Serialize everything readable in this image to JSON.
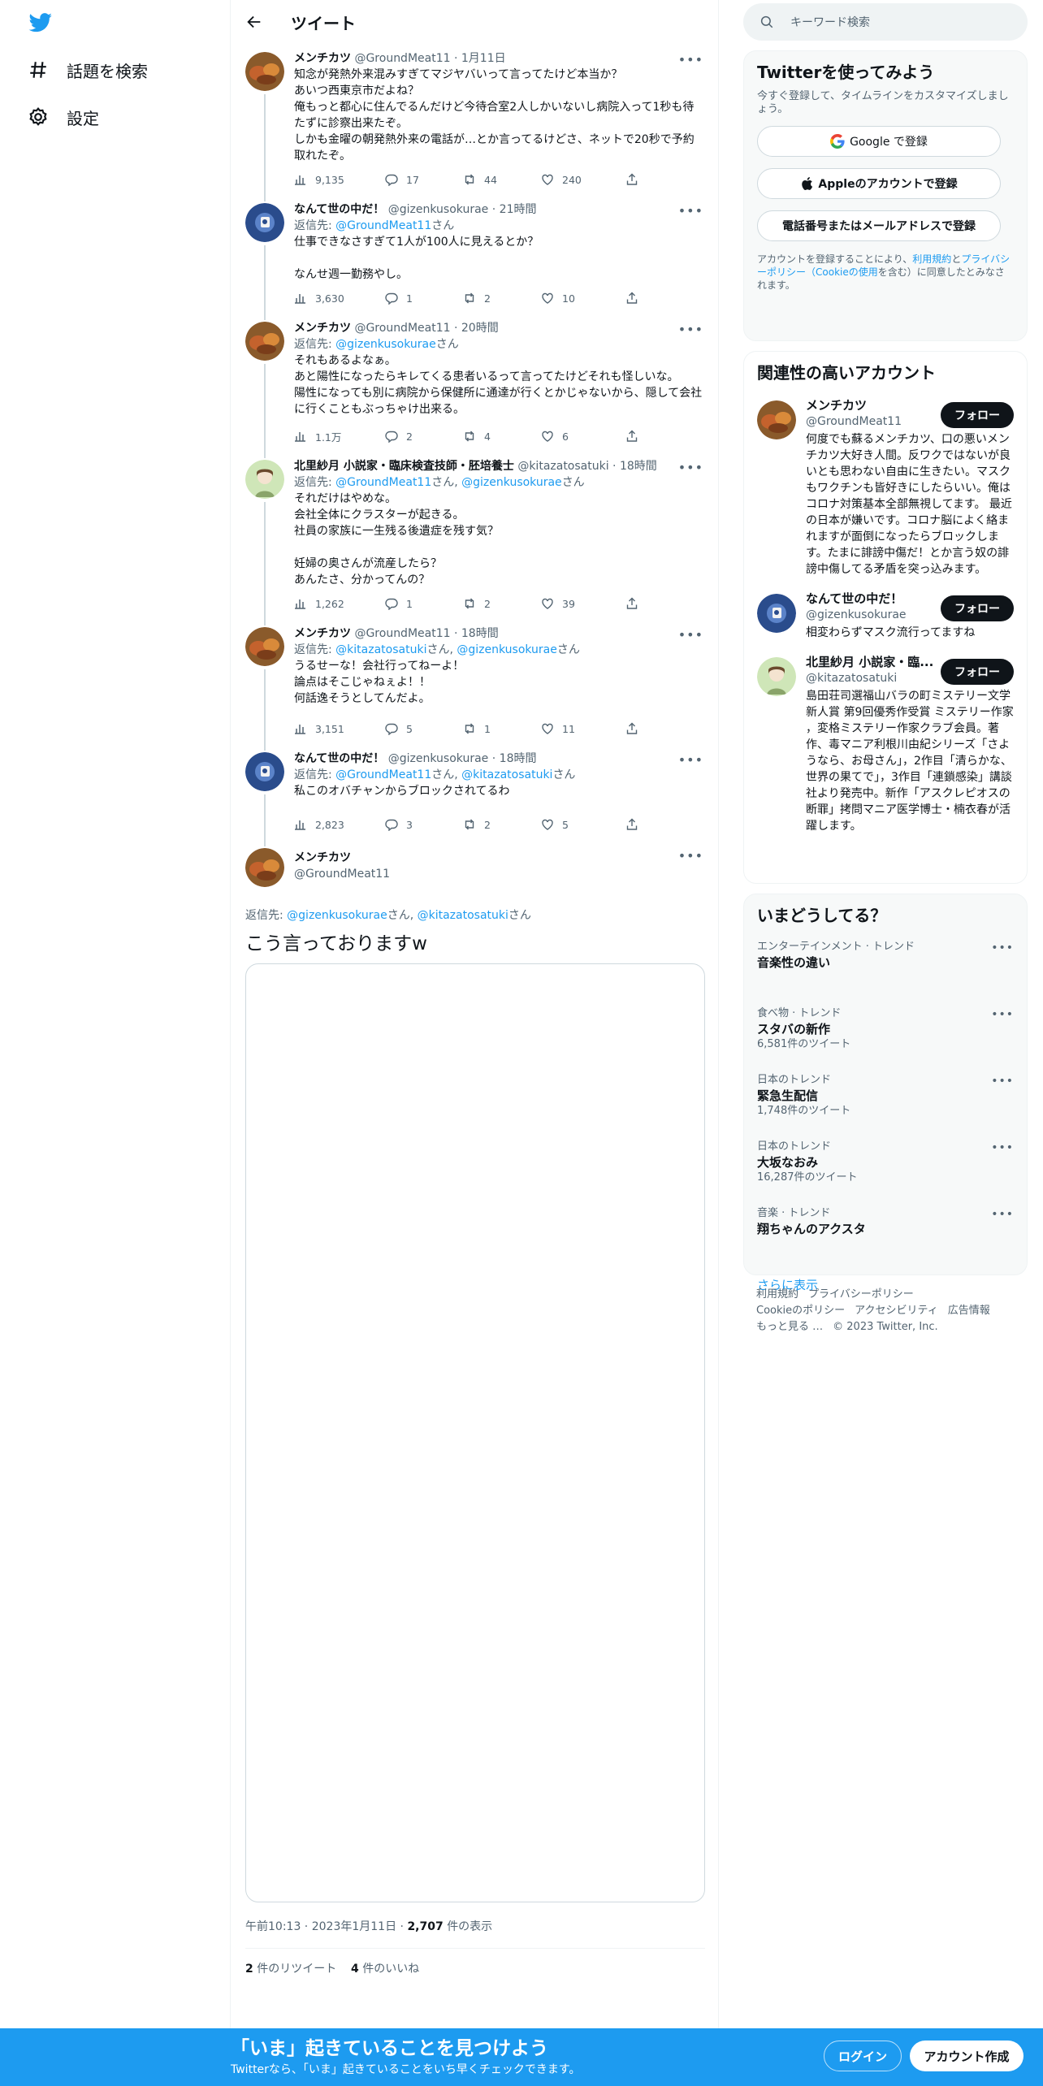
{
  "colors": {
    "accent": "#1d9bf0",
    "text": "#0f1419",
    "muted": "#536471",
    "border": "#eff3f4"
  },
  "nav": {
    "items": [
      {
        "label": "話題を検索",
        "icon": "hashtag-icon"
      },
      {
        "label": "設定",
        "icon": "gear-icon"
      }
    ]
  },
  "header": {
    "title": "ツイート"
  },
  "thread": [
    {
      "name": "メンチカツ",
      "handle": "@GroundMeat11",
      "time": "1月11日",
      "reply_to": "",
      "reply_suffix": "",
      "body": "知念が発熱外来混みすぎてマジヤバいって言ってたけど本当か？\nあいつ西東京市だよね？\n俺もっと都心に住んでるんだけど今待合室2人しかいないし病院入って1秒も待たずに診察出来たぞ。\nしかも金曜の朝発熱外来の電話が…とか言ってるけどさ、ネットで20秒で予約取れたぞ。",
      "views": "9,135",
      "replies": "17",
      "retweets": "44",
      "likes": "240"
    },
    {
      "name": "なんて世の中だ！",
      "handle": "@gizenkusokurae",
      "time": "21時間",
      "reply_to": "@GroundMeat11",
      "reply_suffix": "さん",
      "body": "仕事できなさすぎて1人が100人に見えるとか？\n\nなんせ週一勤務やし。",
      "views": "3,630",
      "replies": "1",
      "retweets": "2",
      "likes": "10"
    },
    {
      "name": "メンチカツ",
      "handle": "@GroundMeat11",
      "time": "20時間",
      "reply_to": "@gizenkusokurae",
      "reply_suffix": "さん",
      "body": "それもあるよなぁ。\nあと陽性になったらキレてくる患者いるって言ってたけどそれも怪しいな。\n陽性になっても別に病院から保健所に通達が行くとかじゃないから、隠して会社に行くこともぶっちゃけ出来る。",
      "views": "1.1万",
      "replies": "2",
      "retweets": "4",
      "likes": "6"
    },
    {
      "name": "北里紗月 小説家・臨床検査技師・胚培養士",
      "handle": "@kitazatosatuki",
      "time": "18時間",
      "reply_to": "@GroundMeat11",
      "reply_suffix": "さん,",
      "reply_to2": "@gizenkusokurae",
      "reply_suffix2": "さん",
      "body": "それだけはやめな。\n会社全体にクラスターが起きる。\n社員の家族に一生残る後遺症を残す気？\n\n妊婦の奥さんが流産したら？\nあんたさ、分かってんの？",
      "views": "1,262",
      "replies": "1",
      "retweets": "2",
      "likes": "39"
    },
    {
      "name": "メンチカツ",
      "handle": "@GroundMeat11",
      "time": "18時間",
      "reply_to": "@kitazatosatuki",
      "reply_suffix": "さん,",
      "reply_to2": "@gizenkusokurae",
      "reply_suffix2": "さん",
      "body": "うるせーな！会社行ってねーよ！\n論点はそこじゃねぇよ！！\n何話逸そうとしてんだよ。",
      "views": "3,151",
      "replies": "5",
      "retweets": "1",
      "likes": "11"
    },
    {
      "name": "なんて世の中だ！",
      "handle": "@gizenkusokurae",
      "time": "18時間",
      "reply_to": "@GroundMeat11",
      "reply_suffix": "さん,",
      "reply_to2": "@kitazatosatuki",
      "reply_suffix2": "さん",
      "body": "私このオバチャンからブロックされてるわ",
      "views": "2,823",
      "replies": "3",
      "retweets": "2",
      "likes": "5"
    }
  ],
  "main_tweet": {
    "name": "メンチカツ",
    "handle": "@GroundMeat11",
    "reply_label": "返信先:",
    "reply_to": "@gizenkusokurae",
    "reply_suffix": "さん,",
    "reply_to2": "@kitazatosatuki",
    "reply_suffix2": "さん",
    "body": "こう言っておりますw",
    "time": "午前10:13",
    "date": "2023年1月11日",
    "views": "2,707",
    "views_label": "件の表示",
    "retweets": "2",
    "retweets_label": "件のリツイート",
    "likes": "4",
    "likes_label": "件のいいね"
  },
  "reply_label": "返信先:",
  "search": {
    "placeholder": "キーワード検索"
  },
  "signup": {
    "title": "Twitterを使ってみよう",
    "subtitle": "今すぐ登録して、タイムラインをカスタマイズしましょう。",
    "google": "Google で登録",
    "apple": "Appleのアカウントで登録",
    "phone": "電話番号またはメールアドレスで登録",
    "legal_1": "アカウントを登録することにより、",
    "legal_terms": "利用規約",
    "legal_and": "と",
    "legal_privacy": "プライバシーポリシー（Cookieの使用",
    "legal_2": "を含む）に同意したとみなされます。"
  },
  "related": {
    "title": "関連性の高いアカウント",
    "follow_label": "フォロー",
    "accounts": [
      {
        "name": "メンチカツ",
        "handle": "@GroundMeat11",
        "bio": "何度でも蘇るメンチカツ、口の悪いメンチカツ大好き人間。反ワクではないが良いとも思わない自由に生きたい。マスクもワクチンも皆好きにしたらいい。俺はコロナ対策基本全部無視してます。 最近の日本が嫌いです。コロナ脳によく絡まれますが面倒になったらブロックします。たまに誹謗中傷だ！とか言う奴の誹謗中傷してる矛盾を突っ込みます。"
      },
      {
        "name": "なんて世の中だ！",
        "handle": "@gizenkusokurae",
        "bio": "相変わらずマスク流行ってますね"
      },
      {
        "name": "北里紗月 小説家・臨...",
        "handle": "@kitazatosatuki",
        "bio": "島田荘司選福山バラの町ミステリー文学新人賞 第9回優秀作受賞 ミステリー作家 ，変格ミステリー作家クラブ会員。著作、毒マニア利根川由紀シリーズ「さようなら、お母さん」，2作目「清らかな、世界の果てで」，3作目「連鎖感染」講談社より発売中。新作「アスクレピオスの断罪」拷問マニア医学博士・楠衣春が活躍します。"
      }
    ]
  },
  "trends": {
    "title": "いまどうしてる？",
    "items": [
      {
        "category": "エンターテインメント · トレンド",
        "name": "音楽性の違い",
        "count": ""
      },
      {
        "category": "食べ物 · トレンド",
        "name": "スタバの新作",
        "count": "6,581件のツイート"
      },
      {
        "category": "日本のトレンド",
        "name": "緊急生配信",
        "count": "1,748件のツイート"
      },
      {
        "category": "日本のトレンド",
        "name": "大坂なおみ",
        "count": "16,287件のツイート"
      },
      {
        "category": "音楽 · トレンド",
        "name": "翔ちゃんのアクスタ",
        "count": ""
      }
    ],
    "show_more": "さらに表示"
  },
  "footer": {
    "links": [
      "利用規約",
      "プライバシーポリシー",
      "Cookieのポリシー",
      "アクセシビリティ",
      "広告情報",
      "もっと見る …"
    ],
    "copyright": "© 2023 Twitter, Inc."
  },
  "bottom_bar": {
    "title": "「いま」起きていることを見つけよう",
    "subtitle": "Twitterなら、「いま」起きていることをいち早くチェックできます。",
    "login": "ログイン",
    "signup": "アカウント作成"
  }
}
